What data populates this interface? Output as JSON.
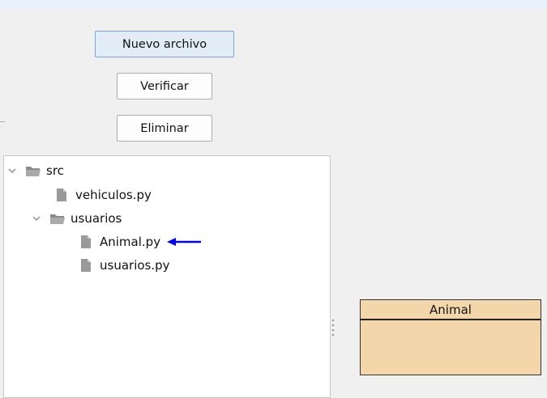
{
  "toolbar": {
    "new_file_label": "Nuevo archivo",
    "verify_label": "Verificar",
    "delete_label": "Eliminar"
  },
  "tree": {
    "root": "src",
    "items": [
      {
        "label": "vehiculos.py",
        "type": "file"
      },
      {
        "label": "usuarios",
        "type": "folder"
      },
      {
        "label": "Animal.py",
        "type": "file"
      },
      {
        "label": "usuarios.py",
        "type": "file"
      }
    ]
  },
  "uml": {
    "class_name": "Animal"
  },
  "colors": {
    "accent_arrow": "#0000ff",
    "uml_fill": "#f3d7ab",
    "primary_button": "#e1ecf7"
  }
}
